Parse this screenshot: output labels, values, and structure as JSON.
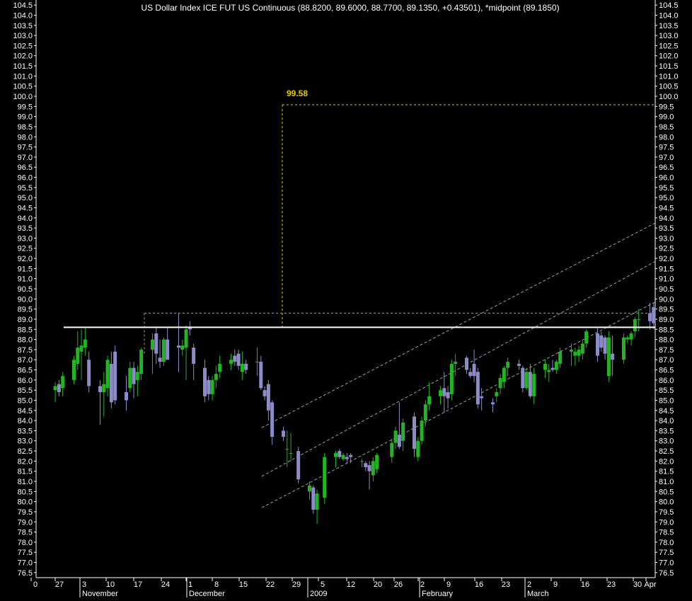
{
  "chart_data": {
    "type": "candlestick",
    "title": "US Dollar Index ICE FUT US Continuous (88.8200, 89.6000, 88.7700, 89.1350, +0.43501), *midpoint (89.1850)",
    "ylim": [
      76.25,
      104.75
    ],
    "y_ticks": [
      76.5,
      77.0,
      77.5,
      78.0,
      78.5,
      79.0,
      79.5,
      80.0,
      80.5,
      81.0,
      81.5,
      82.0,
      82.5,
      83.0,
      83.5,
      84.0,
      84.5,
      85.0,
      85.5,
      86.0,
      86.5,
      87.0,
      87.5,
      88.0,
      88.5,
      89.0,
      89.5,
      90.0,
      90.5,
      91.0,
      91.5,
      92.0,
      92.5,
      93.0,
      93.5,
      94.0,
      94.5,
      95.0,
      95.5,
      96.0,
      96.5,
      97.0,
      97.5,
      98.0,
      98.5,
      99.0,
      99.5,
      100.0,
      100.5,
      101.0,
      101.5,
      102.0,
      102.5,
      103.0,
      103.5,
      104.0,
      104.5
    ],
    "y_tick_labels": [
      "76.5",
      "77.0",
      "77.5",
      "78.0",
      "78.5",
      "79.0",
      "79.5",
      "80.0",
      "80.5",
      "81.0",
      "81.5",
      "82.0",
      "82.5",
      "83.0",
      "83.5",
      "84.0",
      "84.5",
      "85.0",
      "85.5",
      "86.0",
      "86.5",
      "87.0",
      "87.5",
      "88.0",
      "88.5",
      "89.0",
      "89.5",
      "90.0",
      "90.5",
      "91.0",
      "91.5",
      "92.0",
      "92.5",
      "93.0",
      "93.5",
      "94.0",
      "94.5",
      "95.0",
      "95.5",
      "96.0",
      "96.5",
      "97.0",
      "97.5",
      "98.0",
      "98.5",
      "99.0",
      "99.5",
      "100.0",
      "100.5",
      "101.0",
      "101.5",
      "102.0",
      "102.5",
      "103.0",
      "103.5",
      "104.0",
      "104.5"
    ],
    "x_day_labels": [
      "0",
      "27",
      "3",
      "10",
      "17",
      "24",
      "1",
      "8",
      "15",
      "22",
      "29",
      "5",
      "12",
      "20",
      "26",
      "2",
      "9",
      "16",
      "23",
      "2",
      "9",
      "16",
      "23",
      "30",
      "Apr"
    ],
    "x_month_labels": [
      "November",
      "December",
      "2009",
      "February",
      "March"
    ],
    "candles": [
      {
        "date": "2008-10-22",
        "o": 85.5,
        "h": 85.9,
        "l": 84.9,
        "c": 85.7
      },
      {
        "date": "2008-10-23",
        "o": 85.8,
        "h": 86.0,
        "l": 85.2,
        "c": 85.4
      },
      {
        "date": "2008-10-24",
        "o": 85.6,
        "h": 86.4,
        "l": 85.2,
        "c": 86.2
      },
      {
        "date": "2008-10-27",
        "o": 86.0,
        "h": 87.2,
        "l": 85.8,
        "c": 87.0
      },
      {
        "date": "2008-10-28",
        "o": 86.8,
        "h": 88.4,
        "l": 86.5,
        "c": 87.6
      },
      {
        "date": "2008-10-29",
        "o": 87.4,
        "h": 88.5,
        "l": 86.0,
        "c": 87.7
      },
      {
        "date": "2008-10-30",
        "o": 87.6,
        "h": 88.6,
        "l": 87.2,
        "c": 88.0
      },
      {
        "date": "2008-10-31",
        "o": 87.0,
        "h": 87.4,
        "l": 85.4,
        "c": 85.7
      },
      {
        "date": "2008-11-03",
        "o": 85.7,
        "h": 86.0,
        "l": 83.8,
        "c": 85.4
      },
      {
        "date": "2008-11-04",
        "o": 85.4,
        "h": 86.4,
        "l": 84.2,
        "c": 85.8
      },
      {
        "date": "2008-11-05",
        "o": 85.6,
        "h": 87.2,
        "l": 85.2,
        "c": 87.0
      },
      {
        "date": "2008-11-06",
        "o": 86.8,
        "h": 87.4,
        "l": 84.6,
        "c": 84.9
      },
      {
        "date": "2008-11-07",
        "o": 87.4,
        "h": 87.7,
        "l": 84.8,
        "c": 85.0
      },
      {
        "date": "2008-11-10",
        "o": 85.4,
        "h": 86.2,
        "l": 84.5,
        "c": 85.0
      },
      {
        "date": "2008-11-11",
        "o": 85.6,
        "h": 86.9,
        "l": 85.4,
        "c": 86.6
      },
      {
        "date": "2008-11-12",
        "o": 86.6,
        "h": 86.9,
        "l": 85.1,
        "c": 85.8
      },
      {
        "date": "2008-11-13",
        "o": 86.0,
        "h": 86.7,
        "l": 85.2,
        "c": 86.4
      },
      {
        "date": "2008-11-14",
        "o": 86.3,
        "h": 87.6,
        "l": 86.0,
        "c": 87.5
      },
      {
        "date": "2008-11-17",
        "o": 87.5,
        "h": 88.3,
        "l": 86.3,
        "c": 88.0
      },
      {
        "date": "2008-11-18",
        "o": 88.3,
        "h": 88.6,
        "l": 86.8,
        "c": 87.3
      },
      {
        "date": "2008-11-19",
        "o": 87.1,
        "h": 88.0,
        "l": 86.6,
        "c": 86.9
      },
      {
        "date": "2008-11-20",
        "o": 86.9,
        "h": 88.1,
        "l": 86.7,
        "c": 88.0
      },
      {
        "date": "2008-11-21",
        "o": 88.0,
        "h": 88.6,
        "l": 87.6,
        "c": 87.0
      },
      {
        "date": "2008-11-24",
        "o": 87.7,
        "h": 89.3,
        "l": 86.4,
        "c": 87.6
      },
      {
        "date": "2008-11-25",
        "o": 87.5,
        "h": 88.0,
        "l": 87.2,
        "c": 87.7
      },
      {
        "date": "2008-11-26",
        "o": 87.6,
        "h": 88.7,
        "l": 86.0,
        "c": 88.5
      },
      {
        "date": "2008-11-27",
        "o": 88.6,
        "h": 88.9,
        "l": 88.2,
        "c": 88.5
      },
      {
        "date": "2008-11-28",
        "o": 87.6,
        "h": 87.8,
        "l": 86.0,
        "c": 86.8
      },
      {
        "date": "2008-12-01",
        "o": 86.6,
        "h": 87.0,
        "l": 84.9,
        "c": 85.2
      },
      {
        "date": "2008-12-02",
        "o": 86.0,
        "h": 86.2,
        "l": 85.0,
        "c": 85.3
      },
      {
        "date": "2008-12-03",
        "o": 85.3,
        "h": 86.2,
        "l": 85.0,
        "c": 86.0
      },
      {
        "date": "2008-12-04",
        "o": 86.0,
        "h": 86.7,
        "l": 85.6,
        "c": 86.3
      },
      {
        "date": "2008-12-05",
        "o": 86.4,
        "h": 87.2,
        "l": 86.1,
        "c": 86.8
      },
      {
        "date": "2008-12-08",
        "o": 86.8,
        "h": 87.3,
        "l": 86.5,
        "c": 87.0
      },
      {
        "date": "2008-12-09",
        "o": 87.2,
        "h": 87.5,
        "l": 86.7,
        "c": 86.9
      },
      {
        "date": "2008-12-10",
        "o": 87.3,
        "h": 87.5,
        "l": 86.5,
        "c": 86.7
      },
      {
        "date": "2008-12-11",
        "o": 86.4,
        "h": 87.4,
        "l": 86.0,
        "c": 86.8
      },
      {
        "date": "2008-12-12",
        "o": 86.8,
        "h": 87.0,
        "l": 86.3,
        "c": 86.5
      },
      {
        "date": "2008-12-15",
        "o": 86.9,
        "h": 87.6,
        "l": 86.2,
        "c": 86.9
      },
      {
        "date": "2008-12-16",
        "o": 86.9,
        "h": 87.2,
        "l": 85.5,
        "c": 85.6
      },
      {
        "date": "2008-12-17",
        "o": 85.5,
        "h": 85.7,
        "l": 85.0,
        "c": 85.2
      },
      {
        "date": "2008-12-18",
        "o": 85.8,
        "h": 86.0,
        "l": 84.0,
        "c": 84.5
      },
      {
        "date": "2008-12-19",
        "o": 84.9,
        "h": 85.0,
        "l": 82.8,
        "c": 83.2
      },
      {
        "date": "2008-12-22",
        "o": 83.5,
        "h": 83.7,
        "l": 83.0,
        "c": 83.2
      },
      {
        "date": "2008-12-23",
        "o": 82.6,
        "h": 83.5,
        "l": 81.7,
        "c": 82.6
      },
      {
        "date": "2008-12-24",
        "o": 82.4,
        "h": 83.4,
        "l": 82.0,
        "c": 82.4
      },
      {
        "date": "2008-12-26",
        "o": 82.5,
        "h": 82.7,
        "l": 80.9,
        "c": 81.1
      },
      {
        "date": "2008-12-29",
        "o": 80.5,
        "h": 81.0,
        "l": 80.1,
        "c": 80.8
      },
      {
        "date": "2008-12-30",
        "o": 80.7,
        "h": 80.8,
        "l": 79.4,
        "c": 79.6
      },
      {
        "date": "2008-12-31",
        "o": 79.6,
        "h": 80.6,
        "l": 78.9,
        "c": 80.4
      },
      {
        "date": "2009-01-02",
        "o": 80.2,
        "h": 82.4,
        "l": 79.9,
        "c": 82.2
      },
      {
        "date": "2009-01-05",
        "o": 82.2,
        "h": 82.5,
        "l": 81.7,
        "c": 82.4
      },
      {
        "date": "2009-01-06",
        "o": 82.5,
        "h": 82.6,
        "l": 82.1,
        "c": 82.2
      },
      {
        "date": "2009-01-07",
        "o": 82.1,
        "h": 82.4,
        "l": 82.0,
        "c": 82.3
      },
      {
        "date": "2009-01-08",
        "o": 82.2,
        "h": 82.4,
        "l": 81.9,
        "c": 82.1
      },
      {
        "date": "2009-01-09",
        "o": 82.3,
        "h": 82.4,
        "l": 81.9,
        "c": 82.2
      },
      {
        "date": "2009-01-12",
        "o": 82.0,
        "h": 82.1,
        "l": 81.7,
        "c": 82.0
      },
      {
        "date": "2009-01-13",
        "o": 81.9,
        "h": 82.0,
        "l": 81.5,
        "c": 81.7
      },
      {
        "date": "2009-01-14",
        "o": 81.8,
        "h": 82.0,
        "l": 80.6,
        "c": 81.5
      },
      {
        "date": "2009-01-15",
        "o": 81.3,
        "h": 82.2,
        "l": 81.0,
        "c": 82.0
      },
      {
        "date": "2009-01-16",
        "o": 81.6,
        "h": 82.4,
        "l": 81.4,
        "c": 82.3
      },
      {
        "date": "2009-01-20",
        "o": 82.2,
        "h": 83.1,
        "l": 81.9,
        "c": 82.9
      },
      {
        "date": "2009-01-21",
        "o": 82.9,
        "h": 83.7,
        "l": 82.6,
        "c": 83.5
      },
      {
        "date": "2009-01-22",
        "o": 83.3,
        "h": 84.9,
        "l": 82.6,
        "c": 82.7
      },
      {
        "date": "2009-01-23",
        "o": 83.0,
        "h": 84.1,
        "l": 82.5,
        "c": 83.9
      },
      {
        "date": "2009-01-26",
        "o": 84.2,
        "h": 84.4,
        "l": 82.2,
        "c": 82.6
      },
      {
        "date": "2009-01-27",
        "o": 82.2,
        "h": 83.2,
        "l": 82.0,
        "c": 83.0
      },
      {
        "date": "2009-01-28",
        "o": 83.0,
        "h": 84.2,
        "l": 82.8,
        "c": 84.0
      },
      {
        "date": "2009-01-29",
        "o": 84.0,
        "h": 85.0,
        "l": 83.7,
        "c": 84.8
      },
      {
        "date": "2009-01-30",
        "o": 84.8,
        "h": 85.9,
        "l": 84.5,
        "c": 85.2
      },
      {
        "date": "2009-02-02",
        "o": 85.2,
        "h": 85.7,
        "l": 84.8,
        "c": 85.5
      },
      {
        "date": "2009-02-03",
        "o": 85.6,
        "h": 86.4,
        "l": 84.4,
        "c": 85.2
      },
      {
        "date": "2009-02-04",
        "o": 85.4,
        "h": 85.7,
        "l": 84.6,
        "c": 85.1
      },
      {
        "date": "2009-02-05",
        "o": 85.3,
        "h": 87.0,
        "l": 85.0,
        "c": 86.8
      },
      {
        "date": "2009-02-06",
        "o": 86.8,
        "h": 87.3,
        "l": 86.2,
        "c": 86.9
      },
      {
        "date": "2009-02-09",
        "o": 87.1,
        "h": 87.2,
        "l": 86.3,
        "c": 86.5
      },
      {
        "date": "2009-02-10",
        "o": 86.4,
        "h": 86.6,
        "l": 86.1,
        "c": 86.2
      },
      {
        "date": "2009-02-11",
        "o": 86.8,
        "h": 87.5,
        "l": 85.9,
        "c": 86.2
      },
      {
        "date": "2009-02-12",
        "o": 86.4,
        "h": 86.6,
        "l": 84.6,
        "c": 84.8
      },
      {
        "date": "2009-02-13",
        "o": 85.2,
        "h": 85.6,
        "l": 84.5,
        "c": 85.1
      },
      {
        "date": "2009-02-16",
        "o": 84.9,
        "h": 85.1,
        "l": 84.4,
        "c": 84.8
      },
      {
        "date": "2009-02-17",
        "o": 85.2,
        "h": 85.6,
        "l": 84.9,
        "c": 85.4
      },
      {
        "date": "2009-02-18",
        "o": 85.6,
        "h": 86.3,
        "l": 85.3,
        "c": 86.1
      },
      {
        "date": "2009-02-19",
        "o": 85.9,
        "h": 86.7,
        "l": 85.6,
        "c": 86.6
      },
      {
        "date": "2009-02-20",
        "o": 86.6,
        "h": 87.1,
        "l": 86.2,
        "c": 86.9
      },
      {
        "date": "2009-02-23",
        "o": 86.8,
        "h": 87.0,
        "l": 86.5,
        "c": 86.7
      },
      {
        "date": "2009-02-24",
        "o": 86.6,
        "h": 86.7,
        "l": 85.4,
        "c": 85.6
      },
      {
        "date": "2009-02-25",
        "o": 85.6,
        "h": 86.6,
        "l": 85.5,
        "c": 86.4
      },
      {
        "date": "2009-02-26",
        "o": 86.4,
        "h": 86.8,
        "l": 85.1,
        "c": 85.2
      },
      {
        "date": "2009-02-27",
        "o": 85.2,
        "h": 86.6,
        "l": 84.8,
        "c": 86.3
      },
      {
        "date": "2009-03-02",
        "o": 86.5,
        "h": 87.0,
        "l": 86.1,
        "c": 86.8
      },
      {
        "date": "2009-03-03",
        "o": 86.4,
        "h": 86.8,
        "l": 85.9,
        "c": 86.5
      },
      {
        "date": "2009-03-04",
        "o": 86.6,
        "h": 87.0,
        "l": 86.4,
        "c": 86.5
      },
      {
        "date": "2009-03-05",
        "o": 86.5,
        "h": 87.0,
        "l": 86.3,
        "c": 86.9
      },
      {
        "date": "2009-03-06",
        "o": 86.8,
        "h": 87.6,
        "l": 86.6,
        "c": 87.4
      },
      {
        "date": "2009-03-09",
        "o": 87.4,
        "h": 87.8,
        "l": 86.7,
        "c": 87.5
      },
      {
        "date": "2009-03-10",
        "o": 87.2,
        "h": 87.6,
        "l": 86.7,
        "c": 87.4
      },
      {
        "date": "2009-03-11",
        "o": 87.2,
        "h": 87.7,
        "l": 86.9,
        "c": 87.5
      },
      {
        "date": "2009-03-12",
        "o": 87.3,
        "h": 88.0,
        "l": 87.0,
        "c": 87.8
      },
      {
        "date": "2009-03-13",
        "o": 87.8,
        "h": 88.5,
        "l": 87.6,
        "c": 88.4
      },
      {
        "date": "2009-03-16",
        "o": 88.3,
        "h": 88.6,
        "l": 86.9,
        "c": 87.2
      },
      {
        "date": "2009-03-17",
        "o": 88.2,
        "h": 88.4,
        "l": 87.4,
        "c": 87.6
      },
      {
        "date": "2009-03-18",
        "o": 88.1,
        "h": 88.2,
        "l": 87.0,
        "c": 87.3
      },
      {
        "date": "2009-03-19",
        "o": 86.2,
        "h": 88.4,
        "l": 85.9,
        "c": 88.1
      },
      {
        "date": "2009-03-20",
        "o": 87.3,
        "h": 88.2,
        "l": 86.2,
        "c": 87.0
      },
      {
        "date": "2009-03-23",
        "o": 87.0,
        "h": 88.3,
        "l": 86.8,
        "c": 88.1
      },
      {
        "date": "2009-03-24",
        "o": 88.0,
        "h": 88.2,
        "l": 87.8,
        "c": 88.1
      },
      {
        "date": "2009-03-25",
        "o": 88.0,
        "h": 88.4,
        "l": 87.7,
        "c": 88.3
      },
      {
        "date": "2009-03-26",
        "o": 88.4,
        "h": 89.1,
        "l": 88.1,
        "c": 89.0
      },
      {
        "date": "2009-03-27",
        "o": 89.0,
        "h": 89.5,
        "l": 88.4,
        "c": 89.0
      },
      {
        "date": "2009-03-30",
        "o": 89.3,
        "h": 89.8,
        "l": 88.5,
        "c": 88.9
      },
      {
        "date": "2009-03-31",
        "o": 89.6,
        "h": 89.8,
        "l": 88.5,
        "c": 88.8
      },
      {
        "date": "2009-04-01",
        "o": 88.8,
        "h": 89.6,
        "l": 88.8,
        "c": 89.1
      }
    ],
    "annotations": {
      "target_label": "99.58",
      "target_level": 99.58,
      "resistance_level": 88.6,
      "prior_high_level": 89.3
    },
    "colors": {
      "background": "#000000",
      "text": "#ffffff",
      "up_candle": "#22b422",
      "down_candle": "#8c8cc8",
      "target": "#e6c800",
      "channel": "#a0a0a0",
      "resistance": "#ffffff"
    }
  }
}
